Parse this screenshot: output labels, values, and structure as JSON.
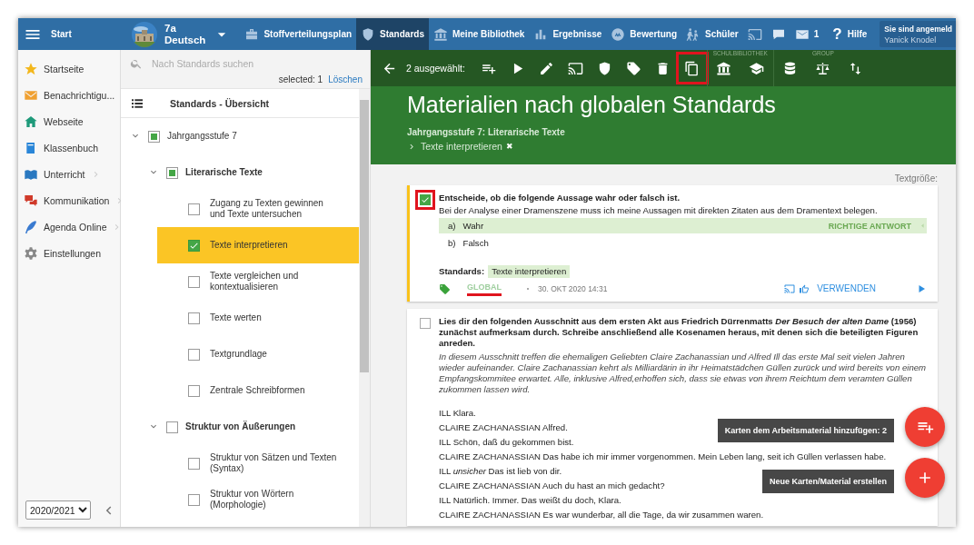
{
  "topbar": {
    "menu_label": "Start",
    "course": {
      "name": "7a",
      "subject": "Deutsch"
    },
    "nav": [
      {
        "kind": "briefcase",
        "label": "Stoffverteilungsplan",
        "selected": false
      },
      {
        "kind": "shield",
        "label": "Standards",
        "selected": true
      },
      {
        "kind": "bank",
        "label": "Meine Bibliothek",
        "selected": false
      },
      {
        "kind": "bars",
        "label": "Ergebnisse",
        "selected": false
      },
      {
        "kind": "badge",
        "label": "Bewertung",
        "selected": false
      },
      {
        "kind": "walkers",
        "label": "Schüler",
        "selected": false
      },
      {
        "kind": "cast",
        "selected": false
      },
      {
        "kind": "chat",
        "selected": false
      },
      {
        "kind": "mail",
        "label": "1",
        "selected": false
      }
    ],
    "help": {
      "symbol": "?",
      "label": "Hilfe"
    },
    "user": {
      "line1": "Sie sind angemeld",
      "name": "Yanick Knodel"
    }
  },
  "sidebar": {
    "items": [
      {
        "kind": "star",
        "label": "Startseite",
        "has_children": false
      },
      {
        "kind": "envelope",
        "label": "Benachrichtigu...",
        "has_children": false
      },
      {
        "kind": "house",
        "label": "Webseite",
        "has_children": false
      },
      {
        "kind": "book",
        "label": "Klassenbuch",
        "has_children": false
      },
      {
        "kind": "openbook",
        "label": "Unterricht",
        "has_children": true
      },
      {
        "kind": "bubbles",
        "label": "Kommunikation",
        "has_children": true
      },
      {
        "kind": "quill",
        "label": "Agenda Online",
        "has_children": true
      },
      {
        "kind": "gear",
        "label": "Einstellungen",
        "has_children": false
      }
    ],
    "year": "2020/2021"
  },
  "tree": {
    "search": {
      "placeholder": "Nach Standards suchen"
    },
    "selected_count": "selected: 1",
    "clear": "Löschen",
    "heading": "Standards - Übersicht",
    "nodes": [
      {
        "label": "Jahrgangsstufe 7",
        "checked": false,
        "partial": true,
        "selected": false,
        "expanded": true,
        "children": [
          {
            "label": "Literarische Texte",
            "checked": false,
            "partial": true,
            "selected": false,
            "expanded": true,
            "children": [
              {
                "label": "Zugang zu Texten gewinnen und Texte untersuchen",
                "checked": false,
                "partial": false,
                "selected": false
              },
              {
                "label": "Texte interpretieren",
                "checked": true,
                "partial": false,
                "selected": true
              },
              {
                "label": "Texte vergleichen und kontextualisieren",
                "checked": false,
                "partial": false,
                "selected": false
              },
              {
                "label": "Texte werten",
                "checked": false,
                "partial": false,
                "selected": false
              },
              {
                "label": "Textgrundlage",
                "checked": false,
                "partial": false,
                "selected": false
              },
              {
                "label": "Zentrale Schreibformen",
                "checked": false,
                "partial": false,
                "selected": false
              }
            ]
          },
          {
            "label": "Struktur von Äußerungen",
            "checked": false,
            "partial": false,
            "selected": false,
            "expanded": true,
            "children": [
              {
                "label": "Struktur von Sätzen und Texten (Syntax)",
                "checked": false,
                "partial": false,
                "selected": false
              },
              {
                "label": "Struktur von Wörtern (Morphologie)",
                "checked": false,
                "partial": false,
                "selected": false
              }
            ]
          }
        ]
      }
    ]
  },
  "toolbar": {
    "count": "2 ausgewählt:",
    "groups": [
      {
        "actions": [
          {
            "kind": "playlist",
            "highlighted": false
          },
          {
            "kind": "play",
            "highlighted": false
          },
          {
            "kind": "pencil",
            "highlighted": false
          },
          {
            "kind": "cast",
            "highlighted": false
          },
          {
            "kind": "shield",
            "highlighted": false
          },
          {
            "kind": "tag",
            "highlighted": false
          },
          {
            "kind": "trash",
            "highlighted": false
          },
          {
            "kind": "copy",
            "highlighted": true
          }
        ]
      },
      {
        "label": "SCHULBIBLIOTHEK",
        "actions": [
          {
            "kind": "bank",
            "highlighted": false
          },
          {
            "kind": "cap",
            "highlighted": false
          }
        ]
      },
      {
        "label": "GROUP",
        "actions": [
          {
            "kind": "database",
            "highlighted": false
          },
          {
            "kind": "scale",
            "highlighted": false
          },
          {
            "kind": "sort",
            "highlighted": false
          }
        ]
      }
    ]
  },
  "header": {
    "title": "Materialien nach globalen Standards",
    "subtitle": "Jahrgangsstufe 7: Literarische Texte",
    "filter": "Texte interpretieren",
    "filter_remove": "✖"
  },
  "text_size_label": "Textgröße:",
  "cards": [
    {
      "selected": true,
      "checked": true,
      "highlighted": true,
      "question": "Entscheide, ob die folgende Aussage wahr oder falsch ist.",
      "prompt": "Bei der Analyse einer Dramenszene muss ich meine Aussagen mit direkten Zitaten aus dem Dramentext belegen.",
      "options": [
        {
          "letter": "a)",
          "text": "Wahr",
          "correct": true
        },
        {
          "letter": "b)",
          "text": "Falsch",
          "correct": false
        }
      ],
      "correct_label": "RICHTIGE ANTWORT",
      "standards_label": "Standards:",
      "standards": [
        "Texte interpretieren"
      ],
      "scope": "GLOBAL",
      "scope_underlined": true,
      "date": "30. OKT 2020 14:31",
      "use_label": "VERWENDEN"
    },
    {
      "selected": false,
      "checked": false,
      "highlighted": false,
      "question": "Lies dir den folgenden Ausschnitt aus dem ersten Akt aus Friedrich Dürrenmatts *Der Besuch der alten Dame* (1956) zunächst aufmerksam durch. Schreibe anschließend alle Kosenamen heraus, mit denen sich die beteiligten Figuren anreden.",
      "intro": "In diesem Ausschnitt treffen die ehemaligen Geliebten Claire Zachanassian und Alfred Ill das erste Mal seit vielen Jahren wieder aufeinander. Claire Zachanassian kehrt als Milliardärin in ihr Heimatstädchen Güllen zurück und wird bereits von einem Empfangskommitee erwartet. Alle, inklusive Alfred,erhoffen sich, dass sie etwas von ihrem Reichtum dem veramten Güllen zukommen lassen wird.",
      "lines": [
        "ILL Klara.",
        "CLAIRE ZACHANASSIAN Alfred.",
        "ILL Schön, daß du gekommen bist.",
        "CLAIRE ZACHANASSIAN Das habe ich mir immer vorgenommen. Mein Leben lang, seit ich Güllen verlassen habe.",
        "ILL *unsicher* Das ist lieb von dir.",
        "CLAIRE ZACHANASSIAN Auch du hast an mich gedacht?",
        "ILL Natürlich. Immer. Das weißt du doch, Klara.",
        "CLAIRE ZACHANASSIAN Es war wunderbar, all die Tage, da wir zusammen waren."
      ]
    }
  ],
  "fabs": [
    {
      "kind": "playlist",
      "tooltip": "Karten dem Arbeitsmaterial hinzufügen: 2"
    },
    {
      "kind": "plus",
      "tooltip": "Neue Karten/Material erstellen"
    }
  ]
}
